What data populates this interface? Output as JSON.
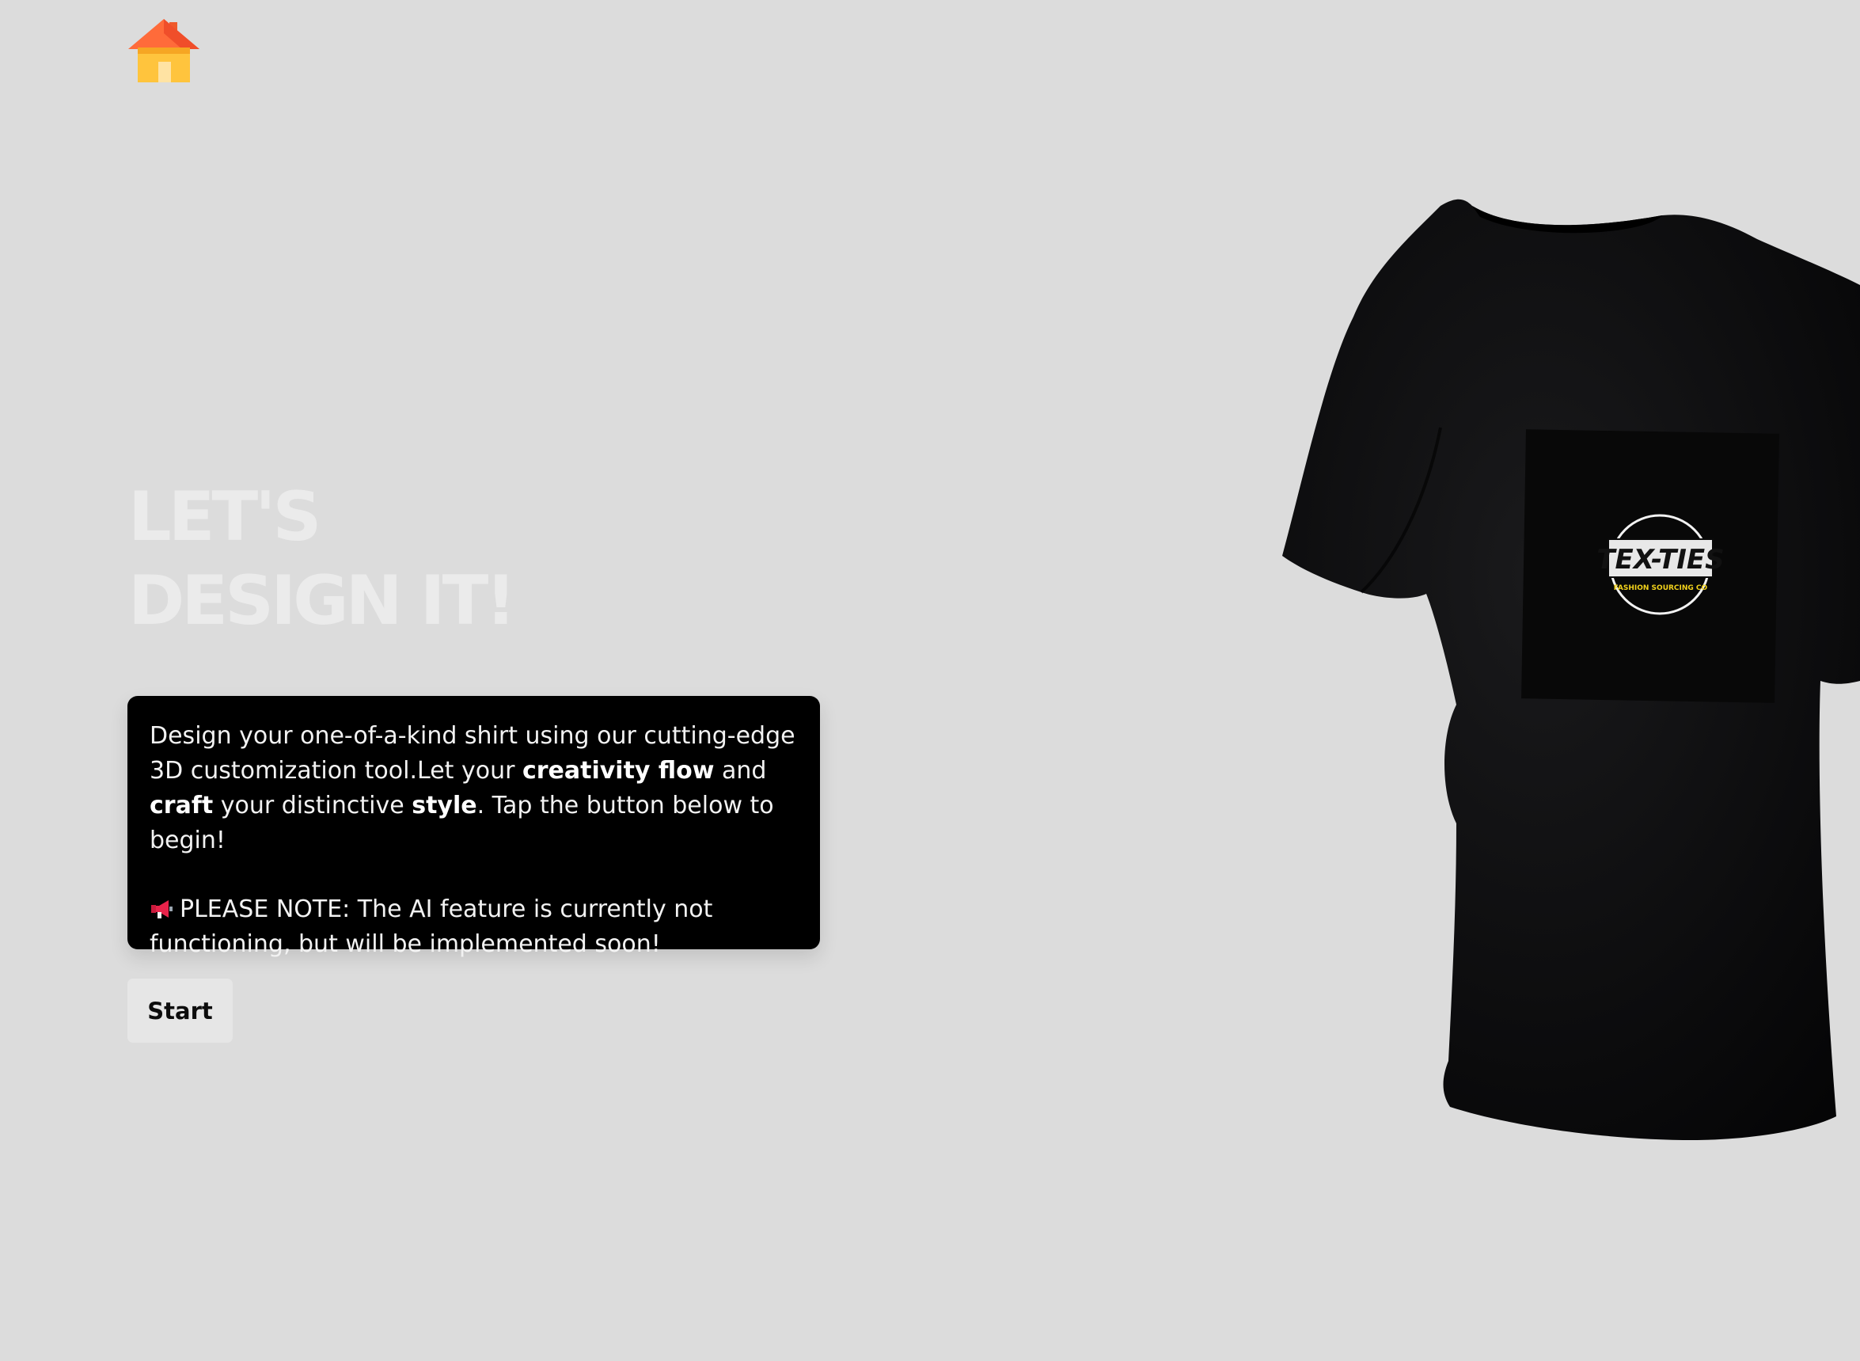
{
  "header": {
    "logo_icon": "home-icon"
  },
  "hero": {
    "headline_line1": "LET'S",
    "headline_line2": "DESIGN IT!",
    "description": {
      "part1": "Design your one-of-a-kind shirt using our cutting-edge 3D customization tool.Let your ",
      "bold1": "creativity flow",
      "part2": " and ",
      "bold2": "craft",
      "part3": " your distinctive ",
      "bold3": "style",
      "part4": ". Tap the button below to begin!"
    },
    "note_icon": "megaphone-icon",
    "note": "PLEASE NOTE: The AI feature is currently not functioning, but will be implemented soon!",
    "start_label": "Start"
  },
  "shirt_preview": {
    "color": "#0d0d0e",
    "logo_text": "TEX-TIES",
    "logo_subtext": "FASHION SOURCING CO"
  },
  "colors": {
    "background": "#dcdcdc",
    "card": "#000000",
    "headline": "#ebebeb",
    "button": "#e6e6e6"
  }
}
